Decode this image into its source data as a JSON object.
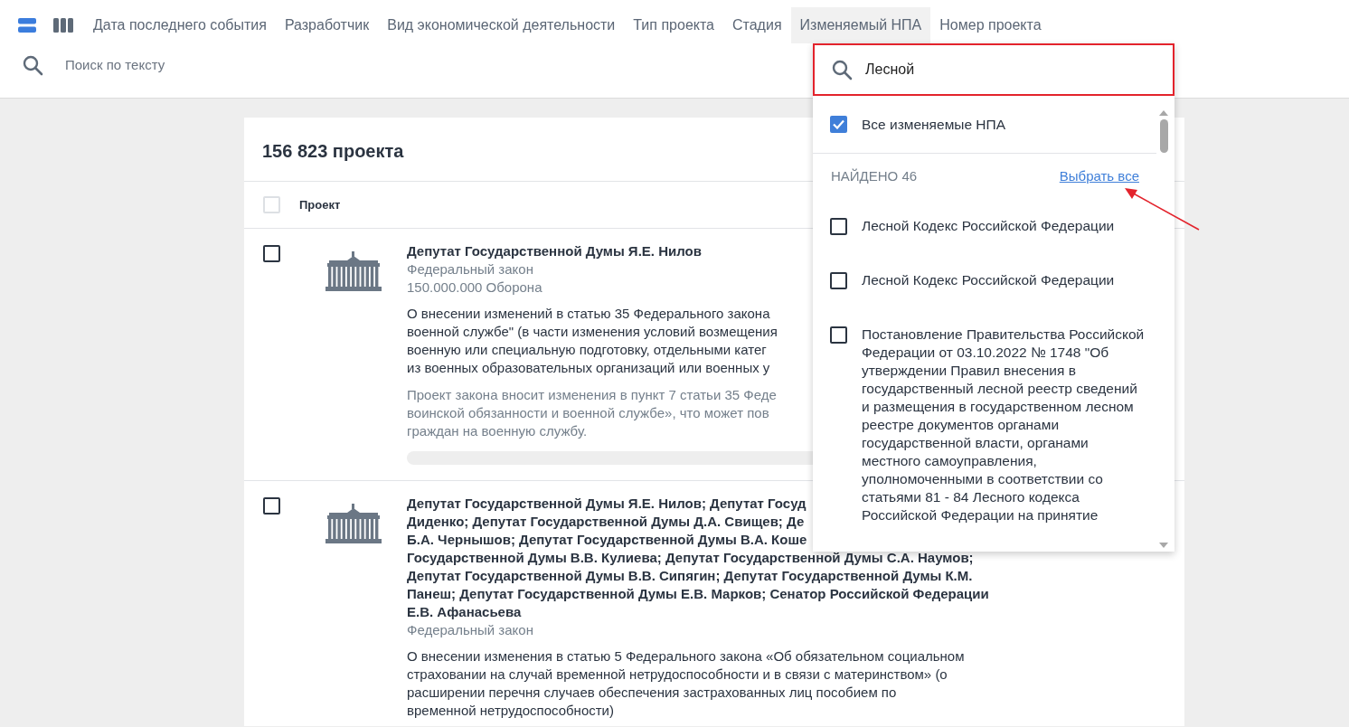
{
  "toolbar": {
    "view_buttons": [
      {
        "kind": "rows",
        "selected": true
      },
      {
        "kind": "columns",
        "selected": false
      }
    ],
    "filters": [
      {
        "label": "Дата последнего события",
        "selected": false
      },
      {
        "label": "Разработчик",
        "selected": false
      },
      {
        "label": "Вид экономической деятельности",
        "selected": false
      },
      {
        "label": "Тип проекта",
        "selected": false
      },
      {
        "label": "Стадия",
        "selected": false
      },
      {
        "label": "Изменяемый НПА",
        "selected": true
      },
      {
        "label": "Номер проекта",
        "selected": false
      }
    ],
    "search": {
      "placeholder": "Поиск по тексту"
    }
  },
  "results": {
    "count": "156 823 проекта",
    "header": {
      "checked": false,
      "column": "Проект"
    },
    "projects": [
      {
        "checked": false,
        "author_lines": [
          "Депутат Государственной Думы Я.Е. Нилов"
        ],
        "type": "Федеральный закон",
        "extra": "150.000.000 Оборона",
        "description_lines": [
          "О внесении изменений в статью 35 Федерального закона",
          "военной службе\" (в части изменения условий возмещения",
          "военную или специальную подготовку, отдельными катег",
          "из военных образовательных организаций или военных у"
        ],
        "summary_lines": [
          "Проект закона вносит изменения в пункт 7 статьи 35 Феде",
          "воинской обязанности и военной службе», что может пов",
          "граждан на военную службу."
        ]
      },
      {
        "checked": false,
        "author_lines": [
          "Депутат Государственной Думы Я.Е. Нилов; Депутат Госуд",
          "Диденко; Депутат Государственной Думы Д.А. Свищев; Де",
          "Б.А. Чернышов; Депутат Государственной Думы В.А. Коше",
          "Государственной Думы В.В. Кулиева; Депутат Государственной Думы С.А. Наумов;",
          "Депутат Государственной Думы В.В. Сипягин; Депутат Государственной Думы К.М.",
          "Панеш; Депутат Государственной Думы Е.В. Марков; Сенатор Российской Федерации",
          "Е.В. Афанасьева"
        ],
        "type": "Федеральный закон",
        "description_lines": [
          "О внесении изменения в статью 5 Федерального закона «Об обязательном социальном",
          "страховании на случай временной нетрудоспособности и в связи с материнством» (о",
          "расширении перечня случаев обеспечения застрахованных лиц пособием по",
          "временной нетрудоспособности)"
        ]
      }
    ]
  },
  "dropdown": {
    "search_value": "Лесной",
    "all": {
      "label": "Все изменяемые НПА",
      "checked": true
    },
    "found": "НАЙДЕНО 46",
    "select_all": "Выбрать все",
    "options": [
      {
        "label": "Лесной Кодекс Российской Федерации",
        "checked": false
      },
      {
        "label": "Лесной Кодекс Российской Федерации",
        "checked": false
      },
      {
        "label": "Постановление Правительства Российской Федерации от 03.10.2022 № 1748 \"Об утверждении Правил внесения в государственный лесной реестр сведений и размещения в государственном лесном реестре документов органами государственной власти, органами местного самоуправления, уполномоченными в соответствии со статьями 81 - 84 Лесного кодекса Российской Федерации на принятие",
        "checked": false
      }
    ]
  }
}
